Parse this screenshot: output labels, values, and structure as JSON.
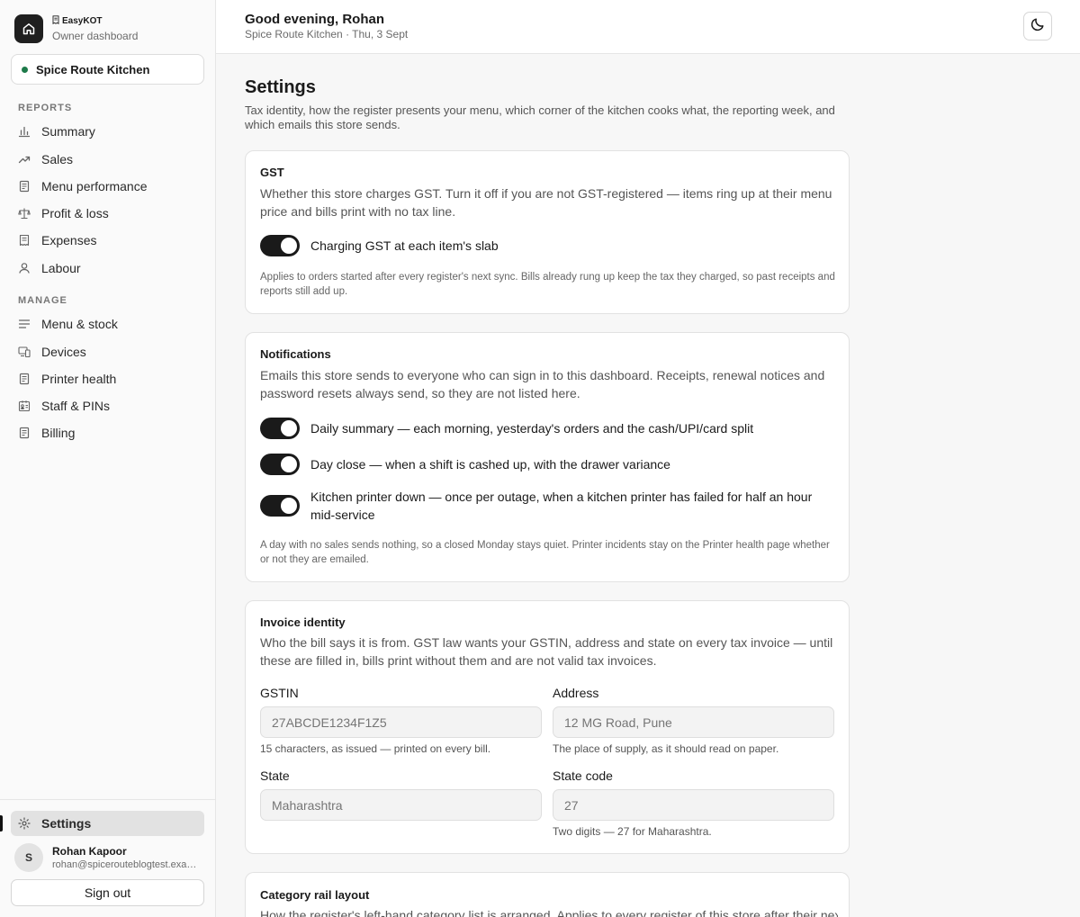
{
  "brand": {
    "name": "EasyKOT",
    "subtitle": "Owner dashboard"
  },
  "store": {
    "name": "Spice Route Kitchen",
    "status_color": "#1e7a4a"
  },
  "nav": {
    "reports_heading": "REPORTS",
    "reports": [
      {
        "label": "Summary",
        "icon": "bar-chart-icon"
      },
      {
        "label": "Sales",
        "icon": "trend-up-icon"
      },
      {
        "label": "Menu performance",
        "icon": "document-icon"
      },
      {
        "label": "Profit & loss",
        "icon": "scale-icon"
      },
      {
        "label": "Expenses",
        "icon": "receipt-icon"
      },
      {
        "label": "Labour",
        "icon": "user-icon"
      }
    ],
    "manage_heading": "MANAGE",
    "manage": [
      {
        "label": "Menu & stock",
        "icon": "list-icon"
      },
      {
        "label": "Devices",
        "icon": "devices-icon"
      },
      {
        "label": "Printer health",
        "icon": "printer-icon"
      },
      {
        "label": "Staff & PINs",
        "icon": "id-card-icon"
      },
      {
        "label": "Billing",
        "icon": "receipt-icon"
      }
    ],
    "settings": {
      "label": "Settings",
      "icon": "gear-icon"
    }
  },
  "user": {
    "initial": "S",
    "name": "Rohan Kapoor",
    "email": "rohan@spicerouteblogtest.example"
  },
  "signout_label": "Sign out",
  "header": {
    "greeting": "Good evening, Rohan",
    "subline": "Spice Route Kitchen · Thu, 3 Sept",
    "theme_icon": "moon-icon"
  },
  "page": {
    "title": "Settings",
    "description": "Tax identity, how the register presents your menu, which corner of the kitchen cooks what, the reporting week, and which emails this store sends."
  },
  "gst": {
    "title": "GST",
    "description": "Whether this store charges GST. Turn it off if you are not GST-registered — items ring up at their menu price and bills print with no tax line.",
    "toggle_label": "Charging GST at each item's slab",
    "toggle_on": true,
    "note": "Applies to orders started after every register's next sync. Bills already rung up keep the tax they charged, so past receipts and reports still add up."
  },
  "notifications": {
    "title": "Notifications",
    "description": "Emails this store sends to everyone who can sign in to this dashboard. Receipts, renewal notices and password resets always send, so they are not listed here.",
    "items": [
      {
        "label": "Daily summary — each morning, yesterday's orders and the cash/UPI/card split",
        "on": true
      },
      {
        "label": "Day close — when a shift is cashed up, with the drawer variance",
        "on": true
      },
      {
        "label": "Kitchen printer down — once per outage, when a kitchen printer has failed for half an hour mid-service",
        "on": true
      }
    ],
    "note": "A day with no sales sends nothing, so a closed Monday stays quiet. Printer incidents stay on the Printer health page whether or not they are emailed."
  },
  "invoice": {
    "title": "Invoice identity",
    "description": "Who the bill says it is from. GST law wants your GSTIN, address and state on every tax invoice — until these are filled in, bills print without them and are not valid tax invoices.",
    "gstin": {
      "label": "GSTIN",
      "placeholder": "27ABCDE1234F1Z5",
      "help": "15 characters, as issued — printed on every bill."
    },
    "address": {
      "label": "Address",
      "placeholder": "12 MG Road, Pune",
      "help": "The place of supply, as it should read on paper."
    },
    "state": {
      "label": "State",
      "placeholder": "Maharashtra"
    },
    "state_code": {
      "label": "State code",
      "placeholder": "27",
      "help": "Two digits — 27 for Maharashtra."
    }
  },
  "category_rail": {
    "title": "Category rail layout",
    "description": "How the register's left-hand category list is arranged. Applies to every register of this store after their next sync."
  }
}
